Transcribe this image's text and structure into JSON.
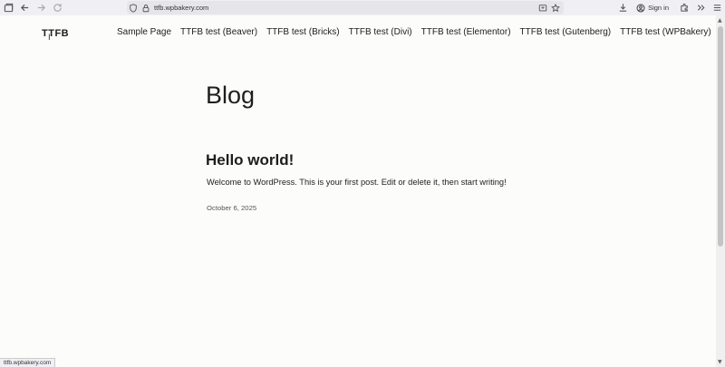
{
  "browser": {
    "url": "ttfb.wpbakery.com",
    "signin_label": "Sign in",
    "status_url": "ttfb.wpbakery.com"
  },
  "site": {
    "logo": "TTFB",
    "nav": [
      "Sample Page",
      "TTFB test (Beaver)",
      "TTFB test (Bricks)",
      "TTFB test (Divi)",
      "TTFB test (Elementor)",
      "TTFB test (Gutenberg)",
      "TTFB test (WPBakery)"
    ]
  },
  "main": {
    "title": "Blog",
    "post": {
      "title": "Hello world!",
      "excerpt": "Welcome to WordPress. This is your first post. Edit or delete it, then start writing!",
      "date": "October 6, 2025"
    }
  }
}
